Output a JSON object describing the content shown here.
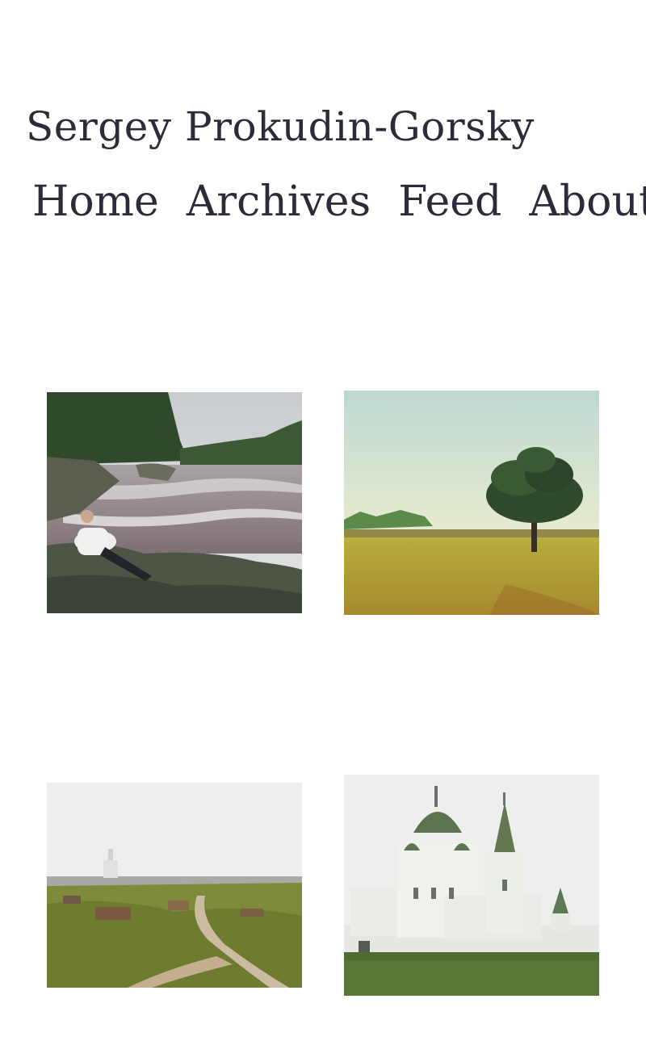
{
  "site": {
    "title": "Sergey Prokudin-Gorsky"
  },
  "nav": {
    "items": [
      {
        "label": "Home"
      },
      {
        "label": "Archives"
      },
      {
        "label": "Feed"
      },
      {
        "label": "About"
      }
    ]
  },
  "gallery": {
    "photos": [
      {
        "subject": "man-by-river-rapids"
      },
      {
        "subject": "lone-pine-tree-in-field"
      },
      {
        "subject": "town-valley-with-church"
      },
      {
        "subject": "white-monastery-green-domes"
      }
    ]
  }
}
